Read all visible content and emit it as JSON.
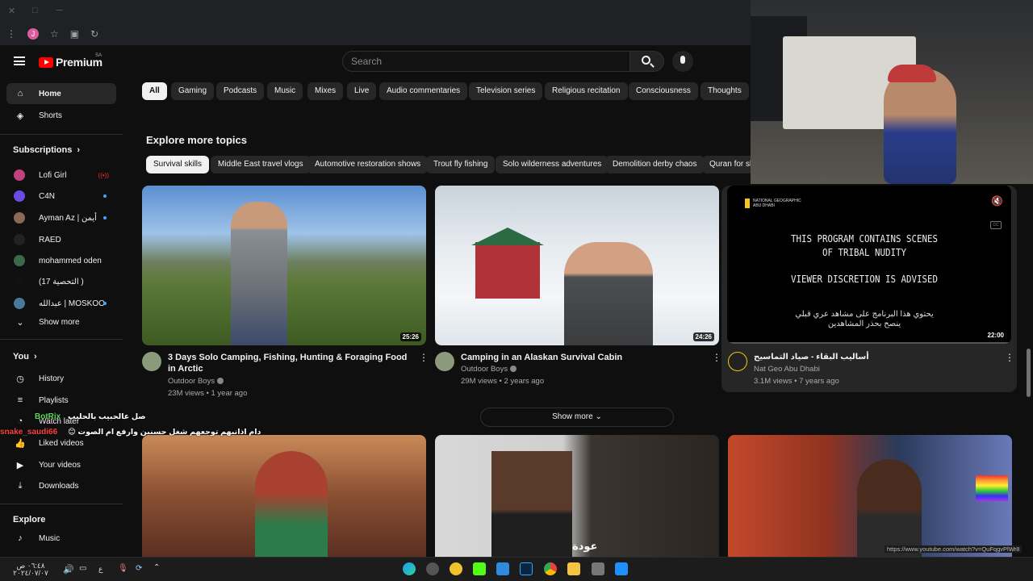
{
  "browser": {
    "window_controls": [
      "✕",
      "□",
      "─"
    ],
    "profile_initial": "J"
  },
  "header": {
    "logo": "Premium",
    "country_code": "SA",
    "search_placeholder": "Search"
  },
  "sidebar": {
    "main": [
      {
        "label": "Home",
        "icon": "home-icon",
        "active": true
      },
      {
        "label": "Shorts",
        "icon": "shorts-icon",
        "active": false
      }
    ],
    "subscriptions_heading": "Subscriptions",
    "subscriptions": [
      {
        "label": "Lofi Girl",
        "indicator": "live",
        "color": "#c0427a"
      },
      {
        "label": "C4N",
        "indicator": "dot",
        "color": "#6b4de6"
      },
      {
        "label": "Ayman Az | أيمن",
        "indicator": "dot",
        "color": "#8a6a55"
      },
      {
        "label": "RAED",
        "indicator": "",
        "color": "#222222"
      },
      {
        "label": "mohammed oden",
        "indicator": "",
        "color": "#3a6a4a"
      },
      {
        "label": "(التحصية 17 )",
        "indicator": "",
        "color": "#111111"
      },
      {
        "label": "عبدالله | MOSKOO",
        "indicator": "dot",
        "color": "#4a7a9a"
      }
    ],
    "show_more": "Show more",
    "you_heading": "You",
    "you": [
      {
        "label": "History",
        "icon": "history-icon"
      },
      {
        "label": "Playlists",
        "icon": "playlists-icon"
      },
      {
        "label": "Watch later",
        "icon": "watch-later-icon"
      },
      {
        "label": "Liked videos",
        "icon": "liked-videos-icon"
      },
      {
        "label": "Your videos",
        "icon": "your-videos-icon"
      },
      {
        "label": "Downloads",
        "icon": "downloads-icon"
      }
    ],
    "explore_heading": "Explore",
    "explore": [
      {
        "label": "Music",
        "icon": "music-icon"
      }
    ]
  },
  "chips": [
    "All",
    "Gaming",
    "Podcasts",
    "Music",
    "Mixes",
    "Live",
    "Audio commentaries",
    "Television series",
    "Religious recitation",
    "Consciousness",
    "Thoughts"
  ],
  "explore_section": {
    "title": "Explore more topics",
    "topics": [
      "Survival skills",
      "Middle East travel vlogs",
      "Automotive restoration shows",
      "Trout fly fishing",
      "Solo wilderness adventures",
      "Demolition derby chaos",
      "Quran for sle"
    ]
  },
  "videos": [
    {
      "title": "3 Days Solo Camping, Fishing, Hunting & Foraging Food in Arctic",
      "channel": "Outdoor Boys",
      "verified": true,
      "views": "23M views",
      "age": "1 year ago",
      "duration": "25:26"
    },
    {
      "title": "Camping in an Alaskan Survival Cabin",
      "channel": "Outdoor Boys",
      "verified": true,
      "views": "29M views",
      "age": "2 years ago",
      "duration": "24:26"
    },
    {
      "title": "أساليب البقاء - صياد التماسيح",
      "channel": "Nat Geo Abu Dhabi",
      "verified": false,
      "views": "3.1M views",
      "age": "7 years ago",
      "duration": "22:00"
    }
  ],
  "preview": {
    "brand": "NATIONAL GEOGRAPHIC ABU DHABI",
    "line1": "THIS PROGRAM CONTAINS SCENES",
    "line2": "OF TRIBAL NUDITY",
    "line3": "VIEWER DISCRETION IS ADVISED",
    "arabic1": "يحتوي هذا البرنامج على مشاهد عري قبلي",
    "arabic2": "ينصح بحذر المشاهدين"
  },
  "show_more_button": "Show more",
  "second_row_caption": "عودة",
  "chat": [
    {
      "name": "BotRix",
      "message": "صل عالحبيب بالحليب",
      "color": "#5bd85b"
    },
    {
      "name": "snake_saudi66",
      "message": "دام اذانيهم توجعهم شغل حسنين وارفع ام الصوت 😊",
      "color": "#ff4040"
    }
  ],
  "status_url": "https://www.youtube.com/watch?v=QuFqgvPlWr8",
  "taskbar": {
    "time": "٠٦:٤٨ ص",
    "date": "٢٠٢٤/٠٧/٠٧",
    "lang": "ع"
  }
}
